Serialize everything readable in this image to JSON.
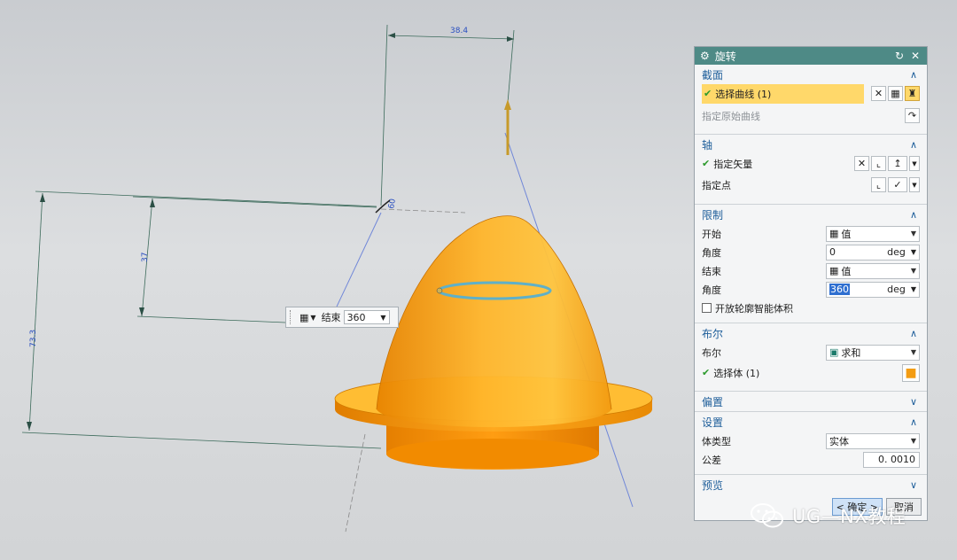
{
  "viewport": {
    "dimensions": {
      "top_width": "38.4",
      "left_total": "73.3",
      "left_inner": "37",
      "angle": "60"
    },
    "floating_input": {
      "label": "结束",
      "value": "360"
    }
  },
  "dialog": {
    "title": "旋转",
    "section_section": {
      "title": "截面",
      "select_curve": "选择曲线 (1)",
      "specify_original_curve": "指定原始曲线"
    },
    "section_axis": {
      "title": "轴",
      "specify_vector": "指定矢量",
      "specify_point": "指定点"
    },
    "section_limits": {
      "title": "限制",
      "start_label": "开始",
      "start_value": "值",
      "start_angle_label": "角度",
      "start_angle_value": "0",
      "end_label": "结束",
      "end_value": "值",
      "end_angle_label": "角度",
      "end_angle_value": "360",
      "unit": "deg",
      "open_profile_label": "开放轮廓智能体积"
    },
    "section_boolean": {
      "title": "布尔",
      "boolean_label": "布尔",
      "boolean_value": "求和",
      "select_body": "选择体 (1)"
    },
    "section_offset": {
      "title": "偏置"
    },
    "section_settings": {
      "title": "设置",
      "body_type_label": "体类型",
      "body_type_value": "实体",
      "tolerance_label": "公差",
      "tolerance_value": "0. 0010"
    },
    "section_preview": {
      "title": "预览"
    },
    "ok_label": "< 确定 >",
    "cancel_label": "取消"
  },
  "watermark": {
    "text": "UG—NX教程"
  },
  "colors": {
    "titlebar": "#4e8a86",
    "section_title": "#1e5e9a",
    "highlight": "#ffd86a",
    "body_orange": "#f5a623"
  }
}
